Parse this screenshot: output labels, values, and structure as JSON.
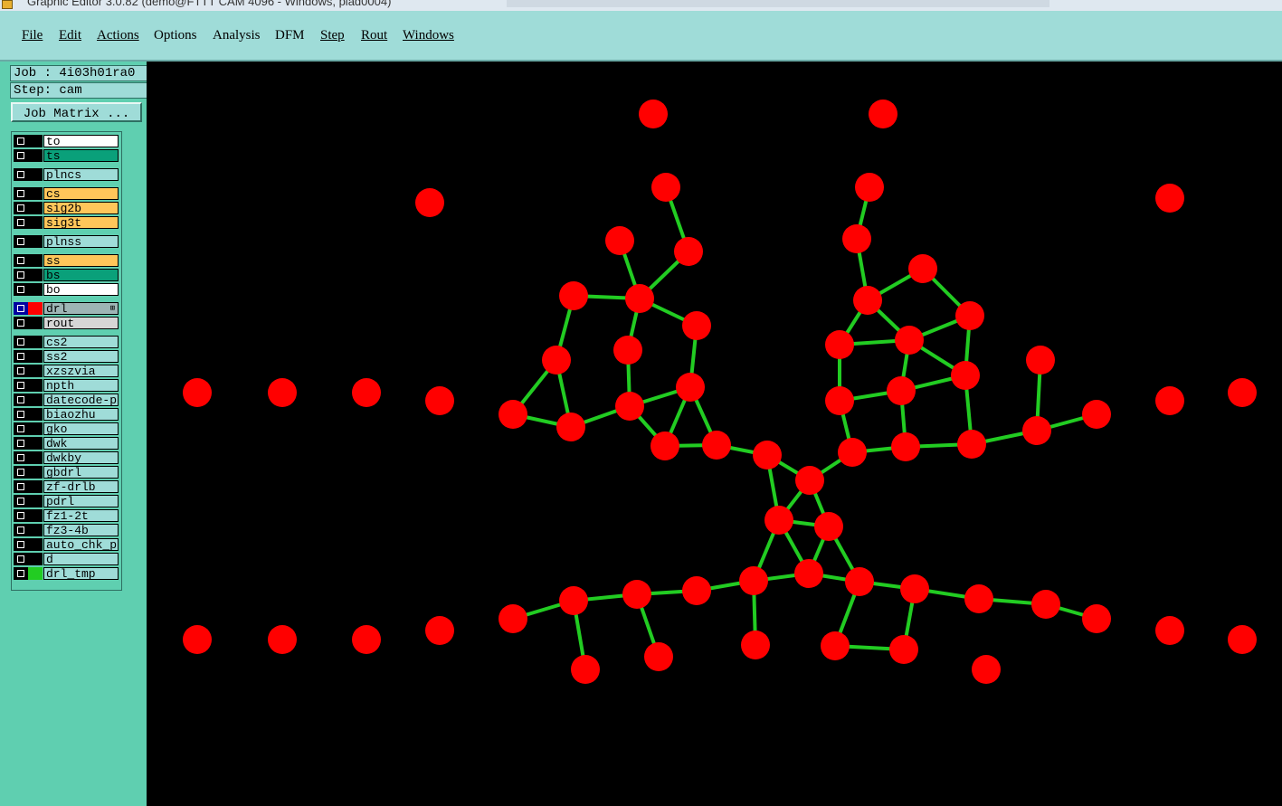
{
  "window": {
    "title": "Graphic Editor 3.0.82 (demo@FTTT CAM 4096 - Windows, plad0004)"
  },
  "menu": [
    {
      "label": "File"
    },
    {
      "label": "Edit"
    },
    {
      "label": "Actions"
    },
    {
      "label": "Options"
    },
    {
      "label": "Analysis"
    },
    {
      "label": "DFM"
    },
    {
      "label": "Step"
    },
    {
      "label": "Rout"
    },
    {
      "label": "Windows"
    }
  ],
  "job": {
    "label": "Job : 4i03h01ra0",
    "step": "Step: cam"
  },
  "job_matrix_button": "Job Matrix ...",
  "colors": {
    "menu_bg": "#9fdcd8",
    "panel_bg": "#5fcfb0",
    "canvas_bg": "#000000",
    "pad": "#ff0000",
    "trace": "#22cc22",
    "layer_white": "#ffffff",
    "layer_teal": "#0aa07a",
    "layer_light": "#9fdcd8",
    "layer_orange": "#ffc65a",
    "layer_grey": "#9eb5b5",
    "layer_lightgrey": "#d6d6d6"
  },
  "layers": [
    {
      "name": "to",
      "bg": "#ffffff",
      "swatch": "#000000"
    },
    {
      "name": "ts",
      "bg": "#0aa07a",
      "swatch": "#000000"
    },
    {
      "name": "plncs",
      "bg": "#9fdcd8",
      "swatch": "#000000"
    },
    {
      "name": "cs",
      "bg": "#ffc65a",
      "swatch": "#000000"
    },
    {
      "name": "sig2b",
      "bg": "#ffc65a",
      "swatch": "#000000"
    },
    {
      "name": "sig3t",
      "bg": "#ffc65a",
      "swatch": "#000000"
    },
    {
      "name": "plnss",
      "bg": "#9fdcd8",
      "swatch": "#000000"
    },
    {
      "name": "ss",
      "bg": "#ffc65a",
      "swatch": "#000000"
    },
    {
      "name": "bs",
      "bg": "#0aa07a",
      "swatch": "#000000"
    },
    {
      "name": "bo",
      "bg": "#ffffff",
      "swatch": "#000000"
    },
    {
      "name": "drl",
      "bg": "#9eb5b5",
      "swatch": "#ff0000",
      "active": true,
      "expand": "⊞"
    },
    {
      "name": "rout",
      "bg": "#d6d6d6",
      "swatch": "#000000"
    },
    {
      "name": "cs2",
      "bg": "#9fdcd8",
      "swatch": "#000000"
    },
    {
      "name": "ss2",
      "bg": "#9fdcd8",
      "swatch": "#000000"
    },
    {
      "name": "xzszvia",
      "bg": "#9fdcd8",
      "swatch": "#000000"
    },
    {
      "name": "npth",
      "bg": "#9fdcd8",
      "swatch": "#000000"
    },
    {
      "name": "datecode-ptc",
      "bg": "#9fdcd8",
      "swatch": "#000000"
    },
    {
      "name": "biaozhu",
      "bg": "#9fdcd8",
      "swatch": "#000000"
    },
    {
      "name": "gko",
      "bg": "#9fdcd8",
      "swatch": "#000000"
    },
    {
      "name": "dwk",
      "bg": "#9fdcd8",
      "swatch": "#000000"
    },
    {
      "name": "dwkby",
      "bg": "#9fdcd8",
      "swatch": "#000000"
    },
    {
      "name": "gbdrl",
      "bg": "#9fdcd8",
      "swatch": "#000000"
    },
    {
      "name": "zf-drlb",
      "bg": "#9fdcd8",
      "swatch": "#000000"
    },
    {
      "name": "pdrl",
      "bg": "#9fdcd8",
      "swatch": "#000000"
    },
    {
      "name": "fz1-2t",
      "bg": "#9fdcd8",
      "swatch": "#000000"
    },
    {
      "name": "fz3-4b",
      "bg": "#9fdcd8",
      "swatch": "#000000"
    },
    {
      "name": "auto_chk_pn",
      "bg": "#9fdcd8",
      "swatch": "#000000"
    },
    {
      "name": "d",
      "bg": "#9fdcd8",
      "swatch": "#000000"
    },
    {
      "name": "drl_tmp",
      "bg": "#9fdcd8",
      "swatch": "#22cc22"
    }
  ]
}
